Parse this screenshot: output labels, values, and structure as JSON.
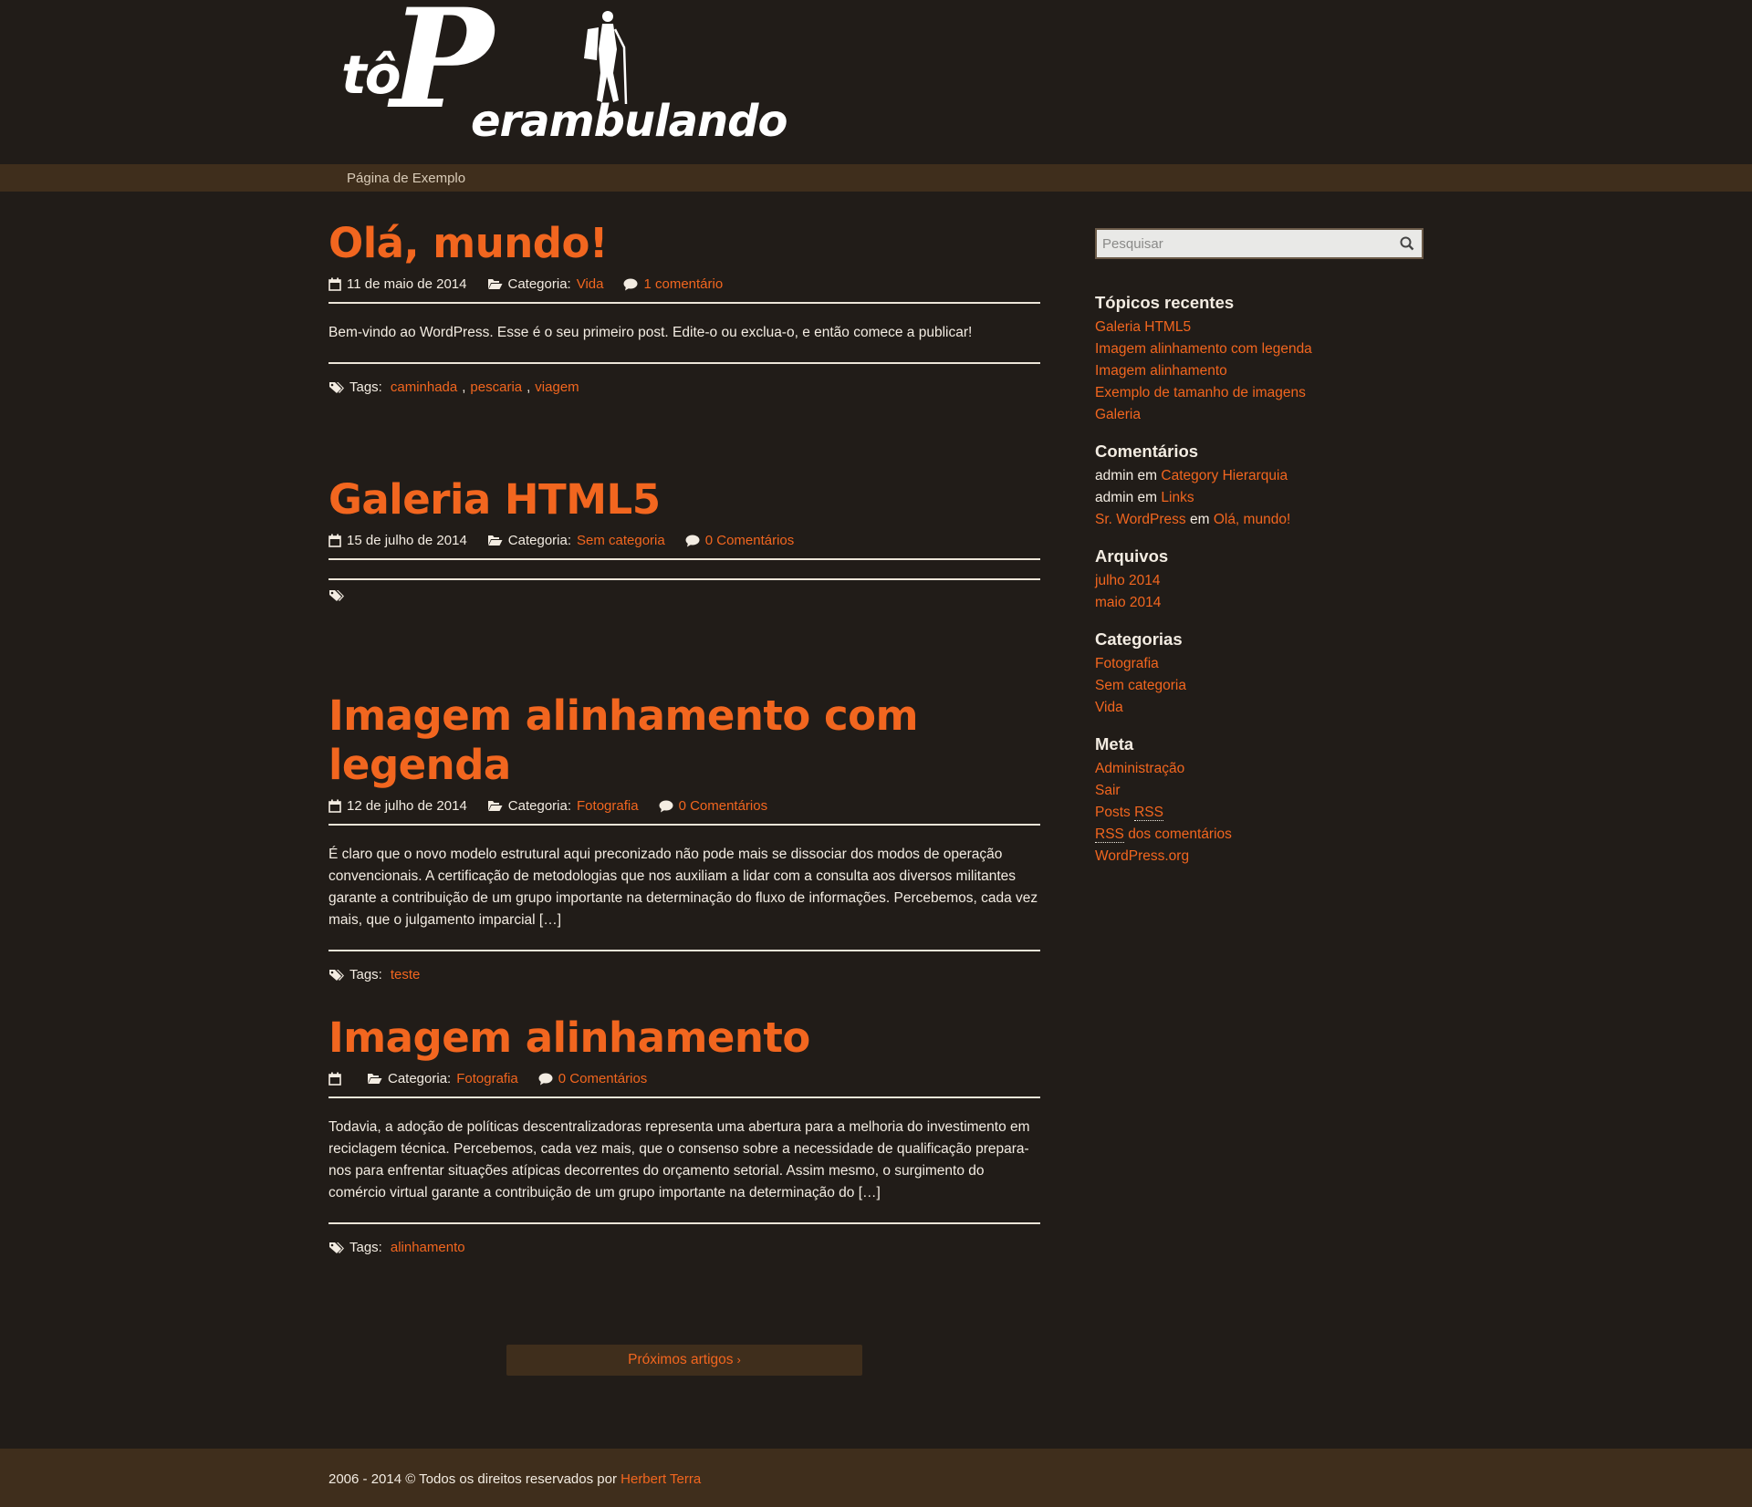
{
  "site": {
    "logo_small": "tô",
    "logo_p": "P",
    "logo_rest": "erambulando",
    "nav": [
      "Página de Exemplo"
    ]
  },
  "colors": {
    "accent": "#f2661f",
    "background": "#211c18",
    "bar": "#3f2e1c",
    "text": "#f3ece2"
  },
  "posts": [
    {
      "title": "Olá, mundo!",
      "date": "11 de maio de 2014",
      "category_label": "Categoria:",
      "category": "Vida",
      "comments": "1 comentário",
      "excerpt": "Bem-vindo ao WordPress. Esse é o seu primeiro post. Edite-o ou exclua-o, e então comece a publicar!",
      "tags_label": "Tags:",
      "tags": [
        "caminhada",
        "pescaria",
        "viagem"
      ]
    },
    {
      "title": "Galeria HTML5",
      "date": "15 de julho de 2014",
      "category_label": "Categoria:",
      "category": "Sem categoria",
      "comments": "0 Comentários",
      "excerpt": "",
      "tags_label": "",
      "tags": []
    },
    {
      "title": "Imagem alinhamento com legenda",
      "date": "12 de julho de 2014",
      "category_label": "Categoria:",
      "category": "Fotografia",
      "comments": "0 Comentários",
      "excerpt": "É claro que o novo modelo estrutural aqui preconizado não pode mais se dissociar dos modos de operação convencionais. A certificação de metodologias que nos auxiliam a lidar com a consulta aos diversos militantes garante a contribuição de um grupo importante na determinação do fluxo de informações. Percebemos, cada vez mais, que o julgamento imparcial […]",
      "tags_label": "Tags:",
      "tags": [
        "teste"
      ]
    },
    {
      "title": "Imagem alinhamento",
      "date": "",
      "category_label": "Categoria:",
      "category": "Fotografia",
      "comments": "0 Comentários",
      "excerpt": "Todavia, a adoção de políticas descentralizadoras representa uma abertura para a melhoria do investimento em reciclagem técnica. Percebemos, cada vez mais, que o consenso sobre a necessidade de qualificação prepara-nos para enfrentar situações atípicas decorrentes do orçamento setorial. Assim mesmo, o surgimento do comércio virtual garante a contribuição de um grupo importante na determinação do […]",
      "tags_label": "Tags:",
      "tags": [
        "alinhamento"
      ]
    }
  ],
  "pager": {
    "next_label": "Próximos artigos"
  },
  "sidebar": {
    "search_placeholder": "Pesquisar",
    "recent": {
      "title": "Tópicos recentes",
      "items": [
        "Galeria HTML5",
        "Imagem alinhamento com legenda",
        "Imagem alinhamento",
        "Exemplo de tamanho de imagens",
        "Galeria"
      ]
    },
    "comments": {
      "title": "Comentários",
      "items": [
        {
          "author": "admin",
          "sep": "em",
          "post": "Category Hierarquia"
        },
        {
          "author": "admin",
          "sep": "em",
          "post": "Links"
        },
        {
          "author": "Sr. WordPress",
          "sep": "em",
          "post": "Olá, mundo!"
        }
      ]
    },
    "archives": {
      "title": "Arquivos",
      "items": [
        "julho 2014",
        "maio 2014"
      ]
    },
    "categories": {
      "title": "Categorias",
      "items": [
        "Fotografia",
        "Sem categoria",
        "Vida"
      ]
    },
    "meta": {
      "title": "Meta",
      "admin": "Administração",
      "logout": "Sair",
      "posts": "Posts",
      "rss": "RSS",
      "comments_rss_suffix": "dos comentários",
      "wordpress": "WordPress.org"
    }
  },
  "footer": {
    "text": "2006 - 2014 © Todos os direitos reservados por",
    "author": "Herbert Terra"
  }
}
